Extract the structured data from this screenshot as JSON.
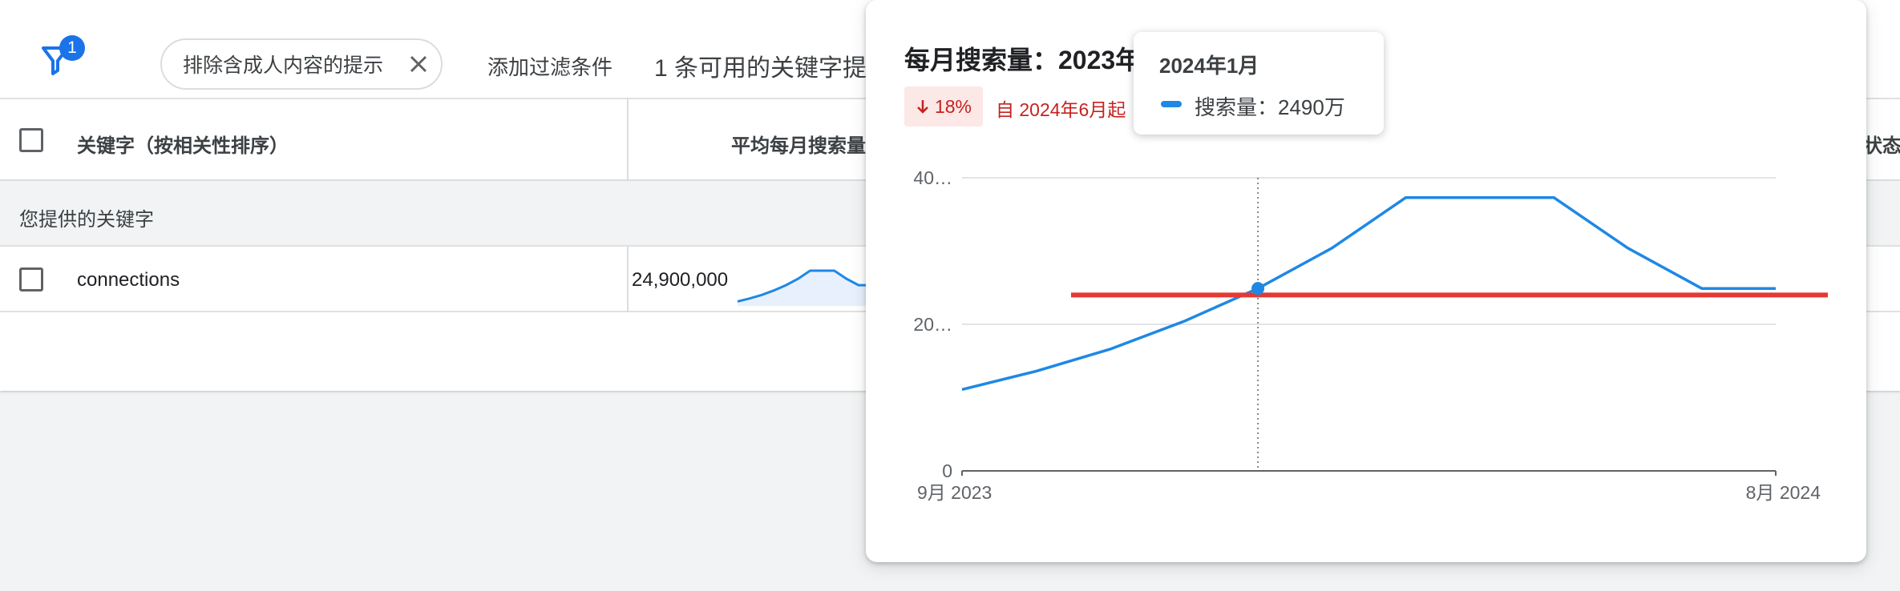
{
  "toolbar": {
    "filter_count": "1",
    "chip_label": "排除含成人内容的提示",
    "add_filter": "添加过滤条件",
    "available_text": "1 条可用的关键字提"
  },
  "table": {
    "header_keyword": "关键字（按相关性排序）",
    "header_avg": "平均每月搜索量",
    "header_status": "状态",
    "group_label": "您提供的关键字",
    "row": {
      "keyword": "connections",
      "avg": "24,900,000"
    }
  },
  "popup": {
    "title": "每月搜索量：2023年",
    "trend_pct": "18%",
    "trend_text": "自 2024年6月起"
  },
  "tooltip": {
    "date": "2024年1月",
    "value": "搜索量：2490万"
  },
  "colors": {
    "series": "#1e88e5",
    "reference_line": "#e53935",
    "badge": "#1a73e8",
    "trend_down": "#c5221f"
  },
  "chart_data": {
    "type": "line",
    "title": "每月搜索量：2023年",
    "yticks": [
      "40…",
      "20…",
      "0"
    ],
    "ylim": [
      0,
      40
    ],
    "xlabels": [
      "9月 2023",
      "8月 2024"
    ],
    "x": [
      "2023-09",
      "2023-10",
      "2023-11",
      "2023-12",
      "2024-01",
      "2024-02",
      "2024-03",
      "2024-04",
      "2024-05",
      "2024-06",
      "2024-07",
      "2024-08"
    ],
    "series": [
      {
        "name": "搜索量",
        "values": [
          11.1,
          13.6,
          16.6,
          20.4,
          24.9,
          30.4,
          37.3,
          37.3,
          37.3,
          30.4,
          24.9,
          24.9
        ]
      }
    ],
    "reference_value": 24.0,
    "highlight_index": 4,
    "grid": true
  }
}
